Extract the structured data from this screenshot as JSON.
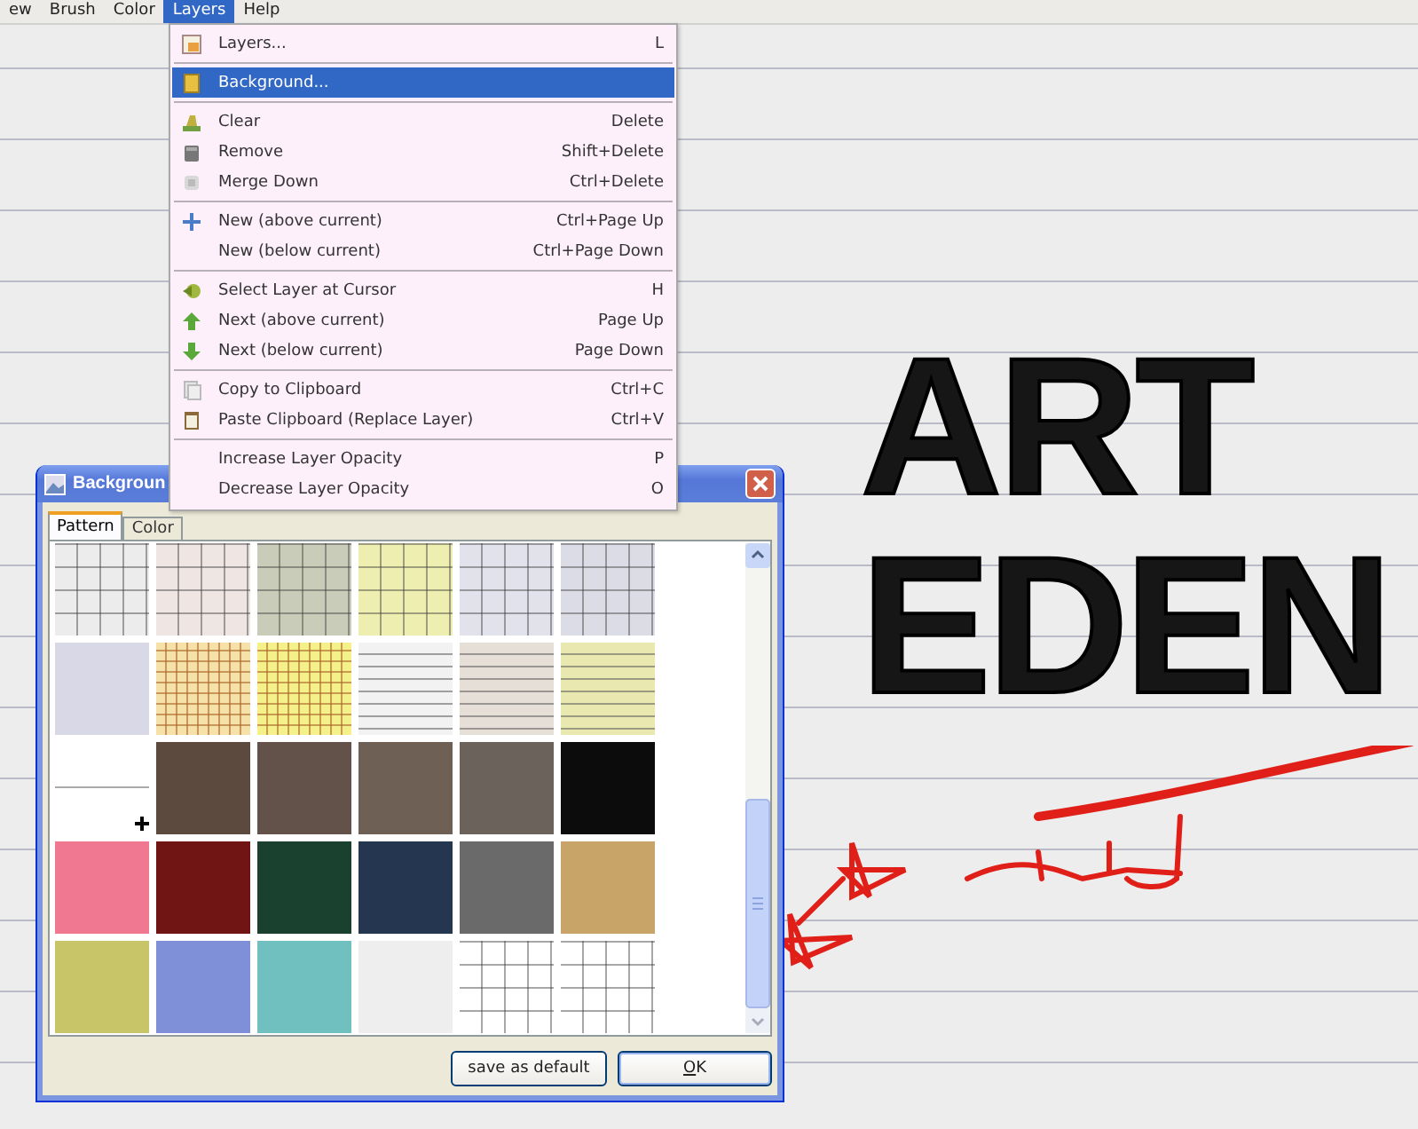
{
  "menubar": [
    {
      "label": "ew",
      "selected": false
    },
    {
      "label": "Brush",
      "selected": false
    },
    {
      "label": "Color",
      "selected": false
    },
    {
      "label": "Layers",
      "selected": true
    },
    {
      "label": "Help",
      "selected": false
    }
  ],
  "menu": {
    "sections": [
      [
        {
          "label": "Layers...",
          "shortcut": "L",
          "selected": false
        }
      ],
      [
        {
          "label": "Background...",
          "selected": true
        }
      ],
      [
        {
          "label": "Clear",
          "shortcut": "Delete",
          "selected": false
        },
        {
          "label": "Remove",
          "shortcut": "Shift+Delete",
          "selected": false
        },
        {
          "label": "Merge Down",
          "shortcut": "Ctrl+Delete",
          "selected": false
        }
      ],
      [
        {
          "label": "New (above current)",
          "shortcut": "Ctrl+Page Up",
          "selected": false
        },
        {
          "label": "New (below current)",
          "shortcut": "Ctrl+Page Down",
          "selected": false
        }
      ],
      [
        {
          "label": "Select Layer at Cursor",
          "shortcut": "H",
          "selected": false
        },
        {
          "label": "Next (above current)",
          "shortcut": "Page Up",
          "selected": false
        },
        {
          "label": "Next (below current)",
          "shortcut": "Page Down",
          "selected": false
        }
      ],
      [
        {
          "label": "Copy to Clipboard",
          "shortcut": "Ctrl+C",
          "selected": false
        },
        {
          "label": "Paste Clipboard (Replace Layer)",
          "shortcut": "Ctrl+V",
          "selected": false
        }
      ],
      [
        {
          "label": "Increase Layer Opacity",
          "shortcut": "P",
          "selected": false
        },
        {
          "label": "Decrease Layer Opacity",
          "shortcut": "O",
          "selected": false
        }
      ]
    ]
  },
  "dialog": {
    "title": "Backgroun",
    "tabs": [
      {
        "label": "Pattern",
        "selected": true
      },
      {
        "label": "Color",
        "selected": false
      }
    ],
    "patterns": [
      {
        "kind": "grid",
        "color": "#ececec"
      },
      {
        "kind": "grid",
        "color": "#efe6e4"
      },
      {
        "kind": "grid",
        "color": "#c9ccb9"
      },
      {
        "kind": "grid",
        "color": "#eeeeb0"
      },
      {
        "kind": "grid",
        "color": "#e2e2ec"
      },
      {
        "kind": "grid",
        "color": "#dcdce6"
      },
      {
        "kind": "plain",
        "color": "#d8d8e6"
      },
      {
        "kind": "finegrid",
        "color": "#f6e2a8"
      },
      {
        "kind": "finegrid",
        "color": "#f4f08a"
      },
      {
        "kind": "lines",
        "color": "#f2f2f2"
      },
      {
        "kind": "lines",
        "color": "#e6dfd8"
      },
      {
        "kind": "lines",
        "color": "#e8e8b0"
      },
      {
        "kind": "blank",
        "color": "#ffffff"
      },
      {
        "kind": "plain",
        "color": "#5c4a3e"
      },
      {
        "kind": "plain",
        "color": "#62524a"
      },
      {
        "kind": "plain",
        "color": "#6e6054"
      },
      {
        "kind": "plain",
        "color": "#6c625c"
      },
      {
        "kind": "plain",
        "color": "#0c0c0c"
      },
      {
        "kind": "plain",
        "color": "#f07890"
      },
      {
        "kind": "plain",
        "color": "#701414"
      },
      {
        "kind": "plain",
        "color": "#1a4030"
      },
      {
        "kind": "plain",
        "color": "#243650"
      },
      {
        "kind": "plain",
        "color": "#6a6a6a"
      },
      {
        "kind": "plain",
        "color": "#c8a468"
      },
      {
        "kind": "plain",
        "color": "#c8c468"
      },
      {
        "kind": "plain",
        "color": "#8090d8"
      },
      {
        "kind": "plain",
        "color": "#70c0c0"
      },
      {
        "kind": "plain",
        "color": "#eeeeee"
      },
      {
        "kind": "grid",
        "color": "#ffffff"
      },
      {
        "kind": "grid",
        "color": "#ffffff"
      }
    ],
    "buttons": [
      {
        "label": "save as default",
        "kind": "plain"
      },
      {
        "label": "OK",
        "kind": "default"
      }
    ]
  },
  "canvas": {
    "lines": [
      "ART",
      "EDEN"
    ]
  }
}
